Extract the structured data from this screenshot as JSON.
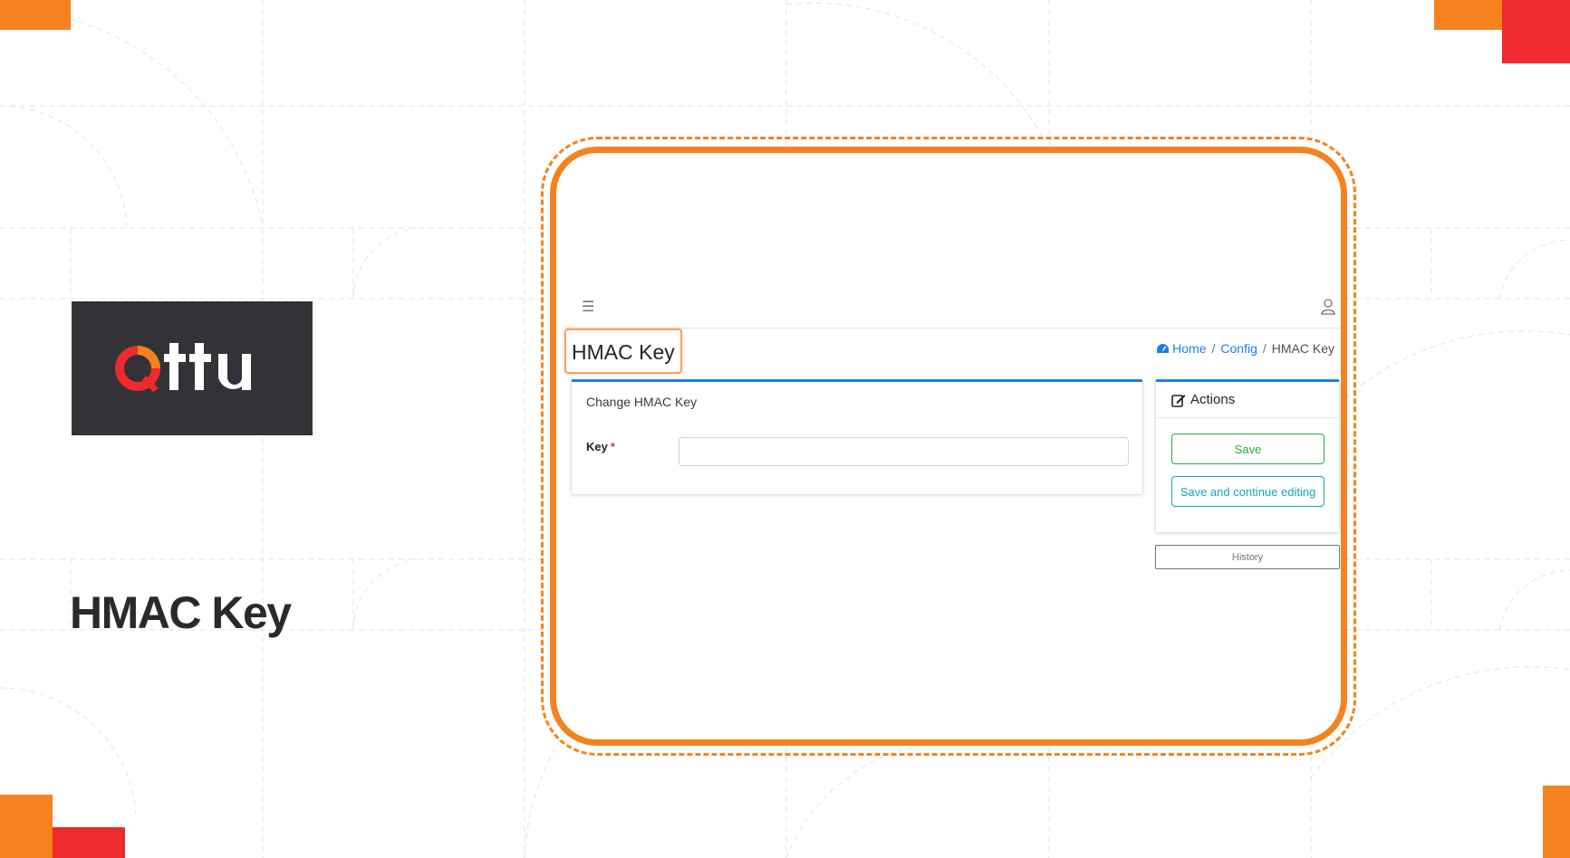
{
  "brand": {
    "logo_text": "Ottu",
    "slide_title": "HMAC Key",
    "colors": {
      "orange": "#f5821f",
      "red": "#ee2a2e",
      "dark": "#333337"
    }
  },
  "app": {
    "topbar": {
      "menu_icon": "hamburger-icon",
      "user_icon": "user-icon"
    },
    "page_title": "HMAC Key",
    "breadcrumb": {
      "home": "Home",
      "config": "Config",
      "current": "HMAC Key"
    },
    "form": {
      "card_title": "Change HMAC Key",
      "key_label": "Key",
      "required_mark": "*",
      "key_value": ""
    },
    "actions": {
      "title": "Actions",
      "save": "Save",
      "save_continue": "Save and continue editing",
      "history": "History"
    },
    "accent_color": "#1e7de6"
  }
}
